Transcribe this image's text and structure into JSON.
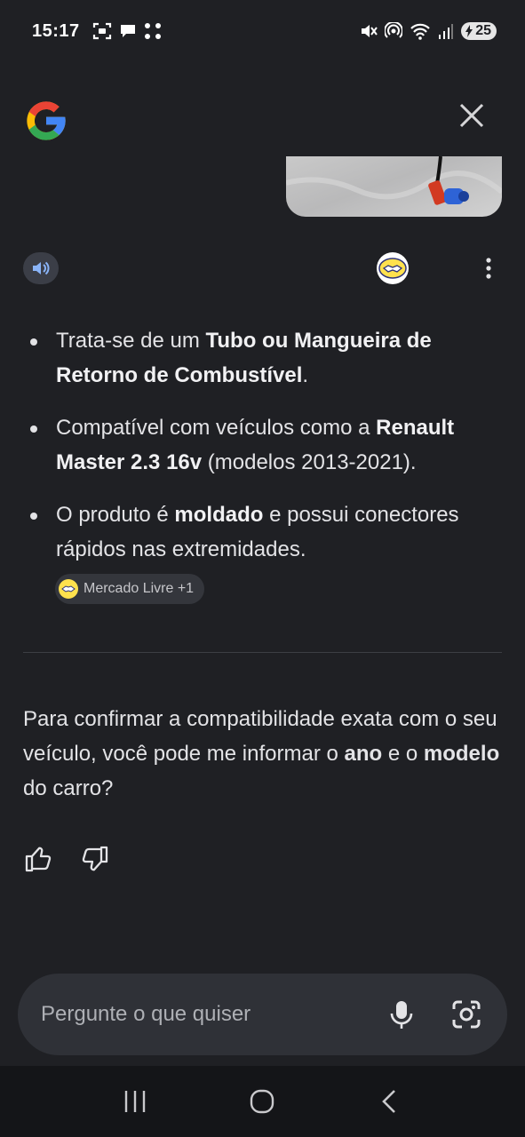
{
  "status_bar": {
    "time": "15:17",
    "battery": "25",
    "left_icons": [
      "screenshot-icon",
      "chat-bubble-icon",
      "download-grid-icon"
    ],
    "right_icons": [
      "mute-icon",
      "hotspot-icon",
      "wifi-icon",
      "signal-icon",
      "battery-icon"
    ]
  },
  "header": {
    "logo": "google-g-icon",
    "close": "close-icon"
  },
  "answer": {
    "bullets": [
      {
        "prefix": "Trata-se de um ",
        "bold": "Tubo ou Mangueira de Retorno de Combustível",
        "suffix": "."
      },
      {
        "prefix": "Compatível com veículos como a ",
        "bold": "Renault Master 2.3 16v",
        "suffix": " (modelos 2013-2021)."
      },
      {
        "prefix": "O produto é ",
        "bold": "moldado",
        "suffix": " e possui conectores rápidos nas extremidades."
      }
    ],
    "source_chip": "Mercado Livre +1"
  },
  "followup": {
    "part1": "Para confirmar a compatibilidade exata com o seu veículo, você pode me informar o ",
    "bold1": "ano",
    "part2": " e o ",
    "bold2": "modelo",
    "part3": " do carro?"
  },
  "input": {
    "placeholder": "Pergunte o que quiser"
  },
  "colors": {
    "background": "#1f2024",
    "surface": "#2f3137",
    "text": "#e3e3e6",
    "speaker_accent": "#8ab4f8"
  }
}
